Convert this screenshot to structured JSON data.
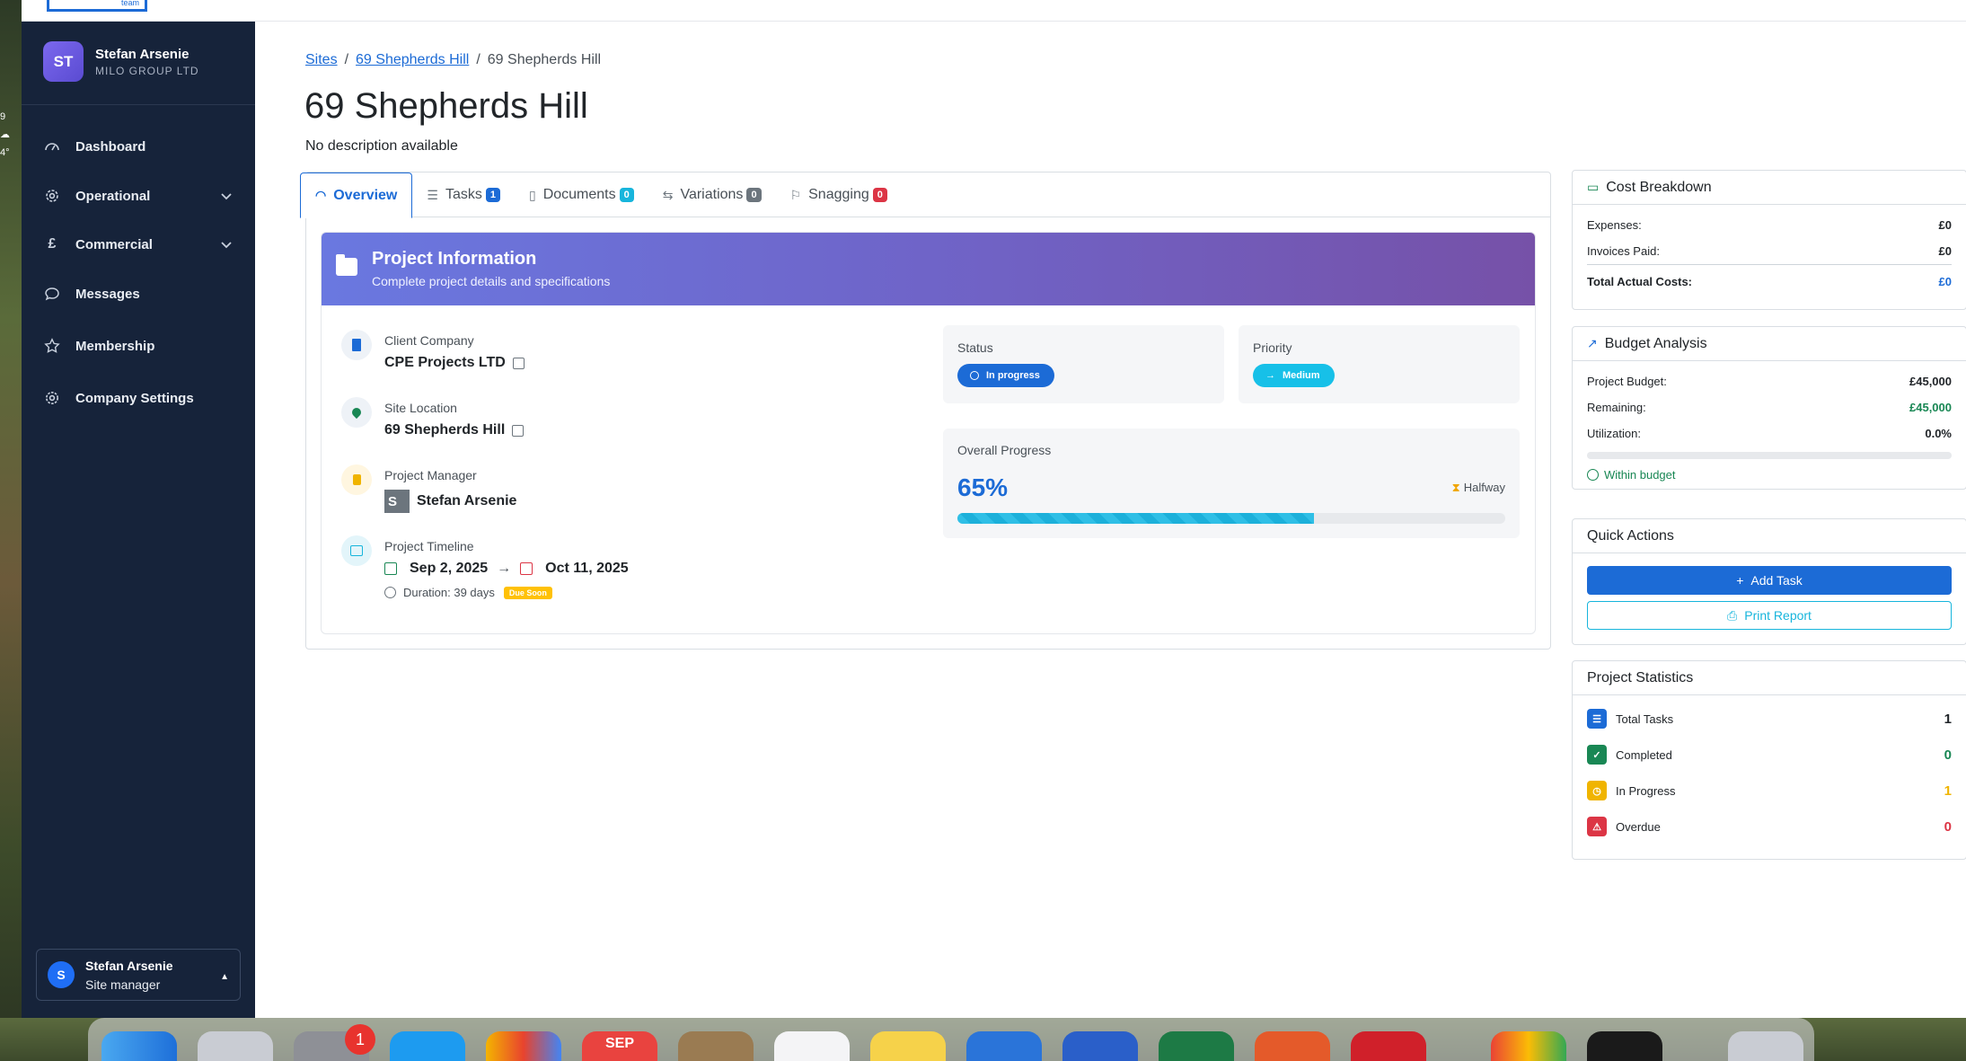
{
  "desktop": {
    "weather_lines": [
      "9",
      "☁",
      "4°"
    ]
  },
  "topbar": {
    "logo_text": "team"
  },
  "sidebar": {
    "user": {
      "initials": "ST",
      "name": "Stefan Arsenie",
      "company": "MILO GROUP LTD"
    },
    "items": [
      {
        "label": "Dashboard",
        "icon": "dashboard-icon"
      },
      {
        "label": "Operational",
        "icon": "gear-icon",
        "expandable": true
      },
      {
        "label": "Commercial",
        "icon": "pound-icon",
        "expandable": true
      },
      {
        "label": "Messages",
        "icon": "chat-icon"
      },
      {
        "label": "Membership",
        "icon": "star-icon"
      },
      {
        "label": "Company Settings",
        "icon": "settings-icon"
      }
    ],
    "footer": {
      "initial": "S",
      "name": "Stefan Arsenie",
      "role": "Site manager"
    }
  },
  "breadcrumb": {
    "items": [
      "Sites",
      "69 Shepherds Hill"
    ],
    "current": "69 Shepherds Hill"
  },
  "page": {
    "title": "69 Shepherds Hill",
    "description": "No description available"
  },
  "tabs": [
    {
      "label": "Overview",
      "active": true,
      "icon": "gauge-icon"
    },
    {
      "label": "Tasks",
      "count": "1",
      "color": "#1c6bd6",
      "icon": "list-icon"
    },
    {
      "label": "Documents",
      "count": "0",
      "color": "#17b5dc",
      "icon": "document-icon"
    },
    {
      "label": "Variations",
      "count": "0",
      "color": "#6c757d",
      "icon": "arrows-icon"
    },
    {
      "label": "Snagging",
      "count": "0",
      "color": "#dc3545",
      "icon": "flag-icon"
    }
  ],
  "project_info": {
    "title": "Project Information",
    "subtitle": "Complete project details and specifications",
    "client_label": "Client Company",
    "client": "CPE Projects LTD",
    "location_label": "Site Location",
    "location": "69 Shepherds Hill",
    "manager_label": "Project Manager",
    "manager_initial": "S",
    "manager": "Stefan Arsenie",
    "timeline_label": "Project Timeline",
    "start_date": "Sep 2, 2025",
    "end_date": "Oct 11, 2025",
    "duration": "Duration: 39 days",
    "due_badge": "Due Soon",
    "status_label": "Status",
    "status": "In progress",
    "priority_label": "Priority",
    "priority": "Medium",
    "progress_label": "Overall Progress",
    "progress_text": "65%",
    "progress_value": 0.65,
    "progress_note": "Halfway"
  },
  "cost_breakdown": {
    "title": "Cost Breakdown",
    "rows": [
      {
        "label": "Expenses:",
        "value": "£0"
      },
      {
        "label": "Invoices Paid:",
        "value": "£0"
      }
    ],
    "total_label": "Total Actual Costs:",
    "total_value": "£0"
  },
  "budget_analysis": {
    "title": "Budget Analysis",
    "budget_label": "Project Budget:",
    "budget_value": "£45,000",
    "remaining_label": "Remaining:",
    "remaining_value": "£45,000",
    "utilization_label": "Utilization:",
    "utilization_value": "0.0%",
    "utilization_fraction": 0,
    "status": "Within budget"
  },
  "quick_actions": {
    "title": "Quick Actions",
    "add_task": "Add Task",
    "print_report": "Print Report"
  },
  "project_statistics": {
    "title": "Project Statistics",
    "items": [
      {
        "label": "Total Tasks",
        "value": "1",
        "color": "#1c6bd6"
      },
      {
        "label": "Completed",
        "value": "0",
        "color": "#198754"
      },
      {
        "label": "In Progress",
        "value": "1",
        "color": "#f0b400"
      },
      {
        "label": "Overdue",
        "value": "0",
        "color": "#dc3545"
      }
    ]
  },
  "dock": {
    "badge": "1",
    "calendar_month": "SEP"
  }
}
